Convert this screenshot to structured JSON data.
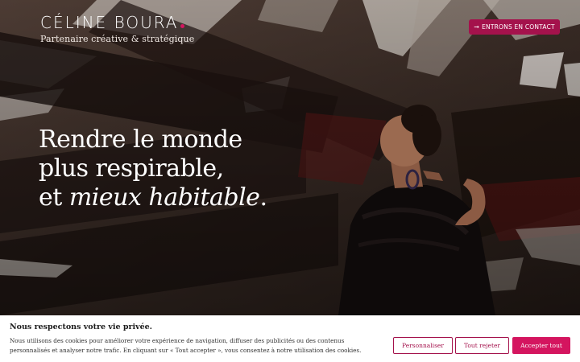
{
  "brand": {
    "name": "CÉLINE BOURA",
    "tagline": "Partenaire créative & stratégique",
    "accent": "#d4155f"
  },
  "header": {
    "contact_icon": "arrow-right-icon",
    "contact_label": "ENTRONS EN CONTACT"
  },
  "hero": {
    "line1": "Rendre le monde",
    "line2": "plus respirable,",
    "line3_prefix": "et ",
    "line3_italic": "mieux habitable",
    "line3_suffix": "."
  },
  "cookie": {
    "title": "Nous respectons votre vie privée.",
    "text": "Nous utilisons des cookies pour améliorer votre expérience de navigation, diffuser des publicités ou des contenus personnalisés et analyser notre trafic. En cliquant sur « Tout accepter », vous consentez à notre utilisation des cookies.",
    "customize_label": "Personnaliser",
    "reject_label": "Tout rejeter",
    "accept_label": "Accepter tout"
  },
  "colors": {
    "brand_primary": "#a4124c",
    "brand_accent": "#d4155f"
  }
}
